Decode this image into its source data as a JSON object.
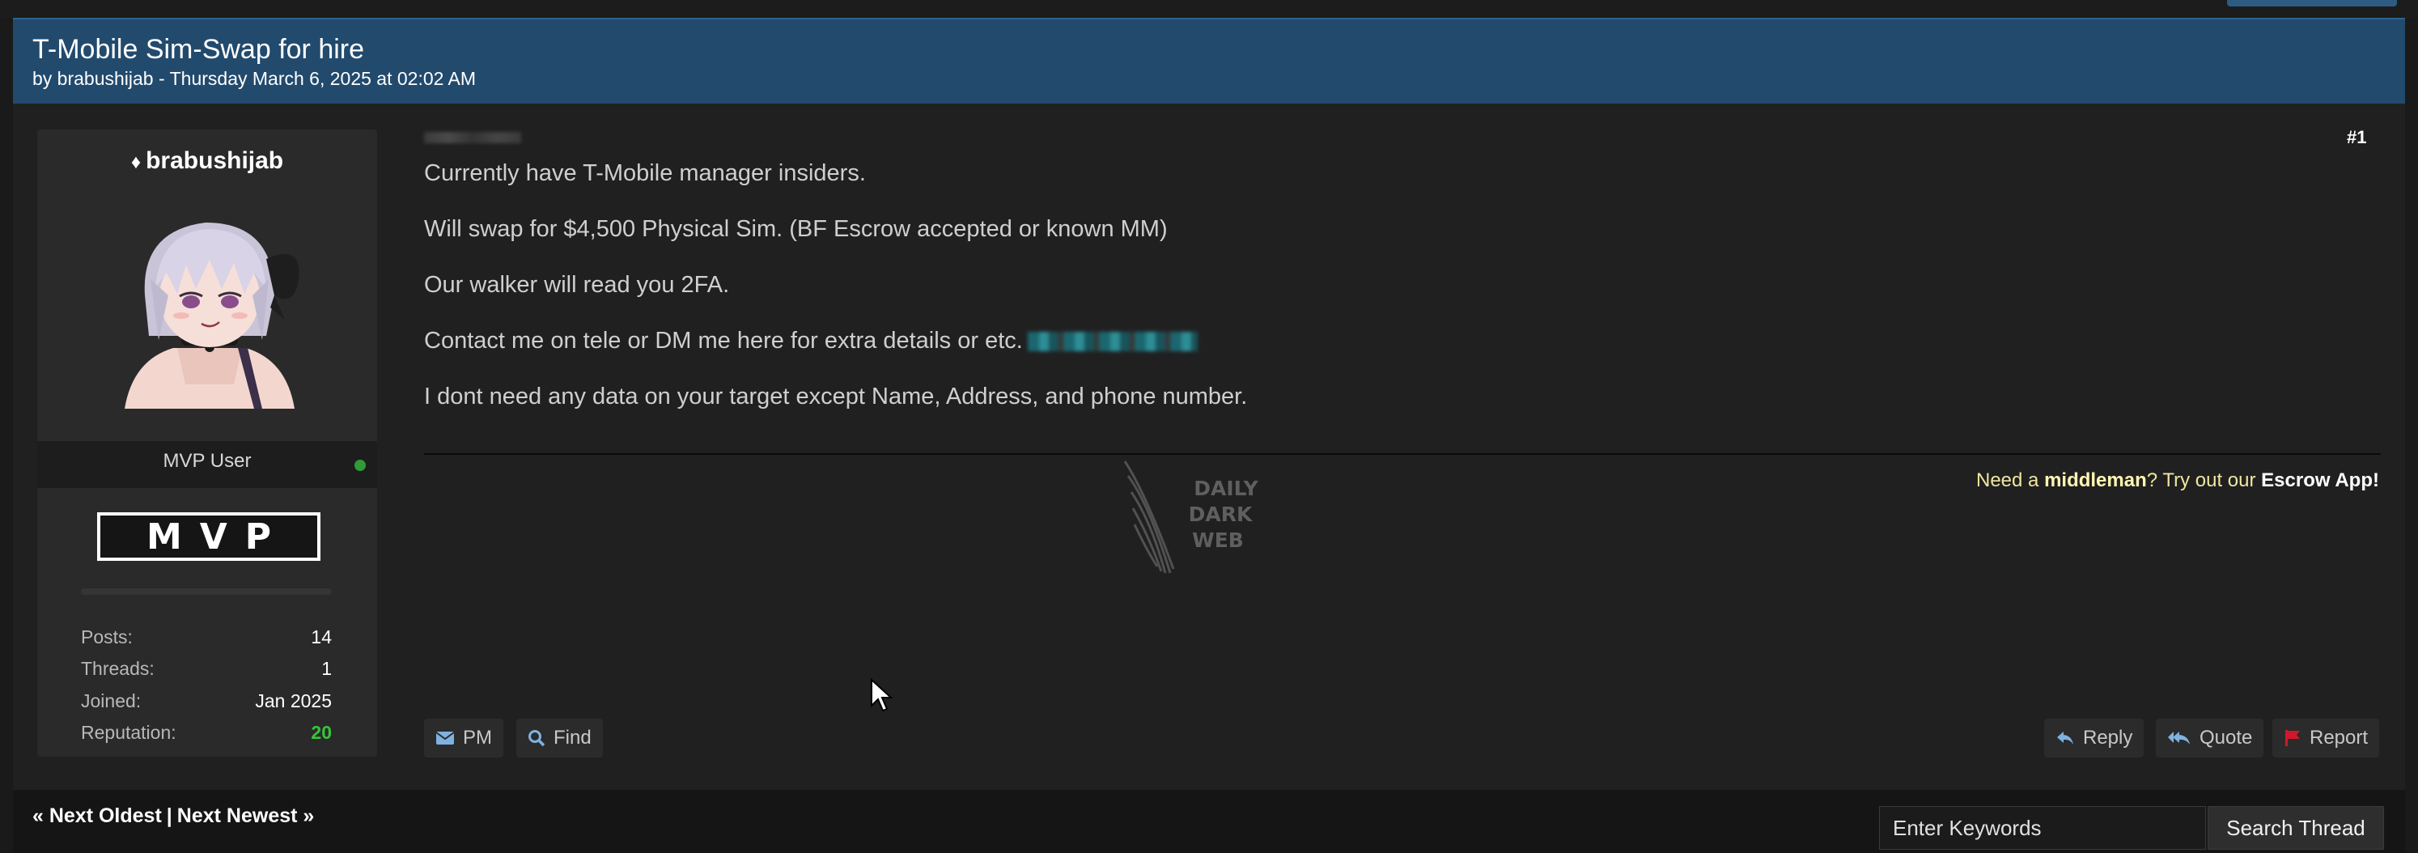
{
  "thread": {
    "title": "T-Mobile Sim-Swap for hire",
    "meta": "by brabushijab - Thursday March 6, 2025 at 02:02 AM"
  },
  "author": {
    "name": "brabushijab",
    "usertitle": "MVP User",
    "badge": "MVP",
    "online_color": "#2e9b3a",
    "stats": [
      {
        "label": "Posts:",
        "value": "14"
      },
      {
        "label": "Threads:",
        "value": "1"
      },
      {
        "label": "Joined:",
        "value": "Jan 2025"
      },
      {
        "label": "Reputation:",
        "value": "20"
      }
    ]
  },
  "post": {
    "number": "#1",
    "lines": [
      "Currently have T-Mobile manager insiders.",
      "Will swap for $4,500 Physical Sim. (BF Escrow accepted or known MM)",
      "Our walker will read you 2FA.",
      "Contact me on tele or DM me here for extra details or etc.",
      "I dont need any data on your target except Name, Address, and phone number."
    ]
  },
  "signature": {
    "prefix": "Need a ",
    "highlight": "middleman",
    "middle": "? Try out our ",
    "app": "Escrow App!",
    "logo_lines": [
      "DAILY",
      "DARK",
      "WEB"
    ]
  },
  "buttons": {
    "pm": "PM",
    "find": "Find",
    "reply": "Reply",
    "quote": "Quote",
    "report": "Report"
  },
  "footer": {
    "next_oldest": "« Next Oldest",
    "separator": "|",
    "next_newest": "Next Newest »",
    "search_placeholder": "Enter Keywords",
    "search_button": "Search Thread"
  },
  "colors": {
    "header_bg": "#224a6d",
    "reputation": "#35c43b",
    "signature_text": "#f1e6a0",
    "report_flag": "#d0182a"
  }
}
